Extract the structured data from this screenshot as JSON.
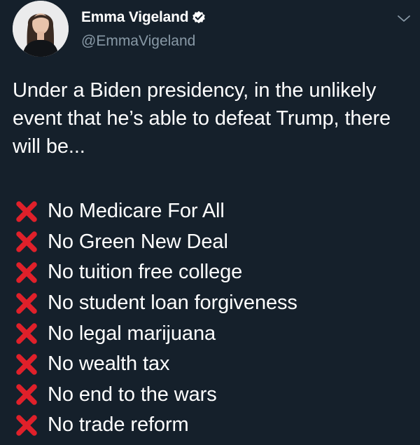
{
  "author": {
    "display_name": "Emma Vigeland",
    "handle": "@EmmaVigeland",
    "verified": true
  },
  "tweet": {
    "text": "Under a Biden presidency, in the unlikely event that he’s able to defeat Trump, there will be...",
    "list_icon": "cross-mark-icon",
    "items": [
      {
        "label": "No Medicare For All"
      },
      {
        "label": "No Green New Deal"
      },
      {
        "label": "No tuition free college"
      },
      {
        "label": "No student loan forgiveness"
      },
      {
        "label": "No legal marijuana"
      },
      {
        "label": "No wealth tax"
      },
      {
        "label": "No end to the wars"
      },
      {
        "label": "No trade reform"
      }
    ]
  },
  "colors": {
    "background": "#15202b",
    "text": "#ffffff",
    "secondary_text": "#8899a6",
    "cross_mark": "#e0202a"
  },
  "icons": {
    "verified": "verified-badge-icon",
    "menu": "chevron-down-icon"
  }
}
